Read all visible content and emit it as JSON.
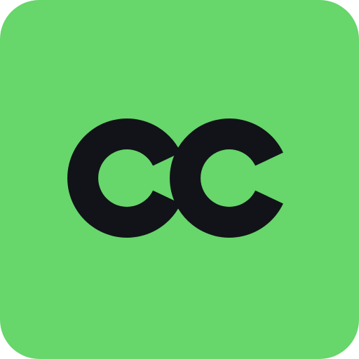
{
  "icon": {
    "name": "cc-app-icon",
    "monogram_text": "cc",
    "colors": {
      "background": "#67d66b",
      "foreground": "#111318"
    }
  }
}
